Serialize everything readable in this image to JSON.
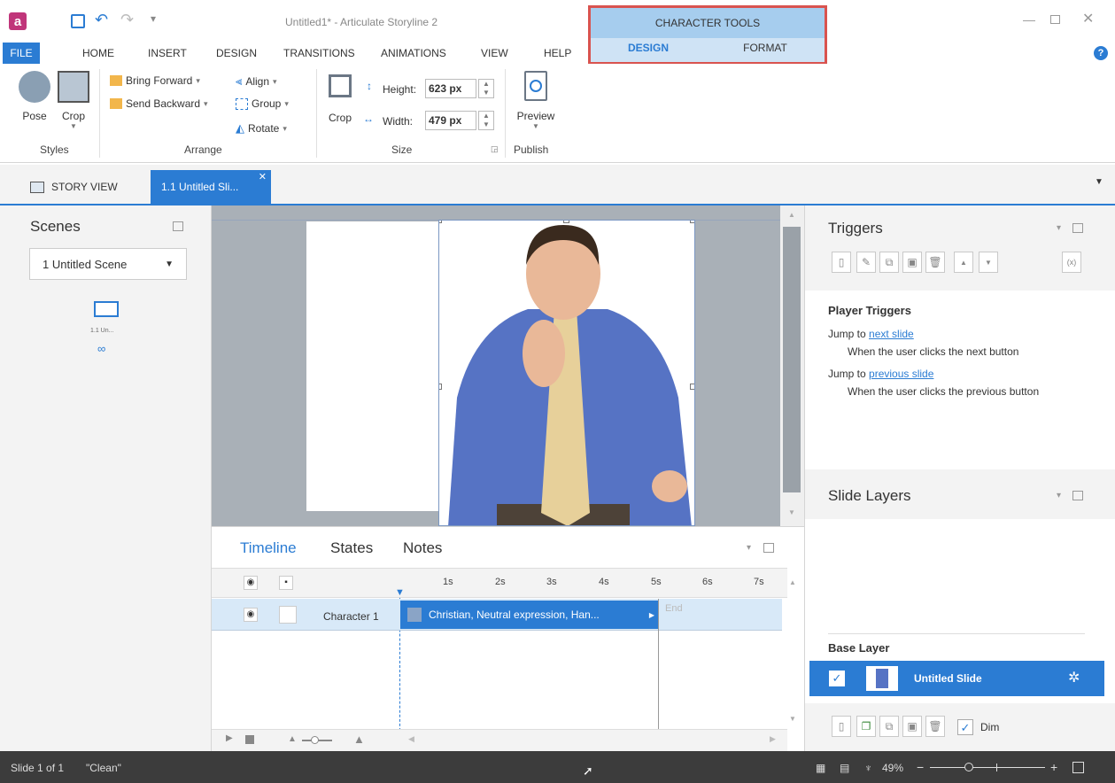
{
  "window": {
    "title": "Untitled1* - Articulate Storyline 2"
  },
  "app_icon": "storyline-a-icon",
  "context_tab": {
    "header": "CHARACTER TOOLS",
    "tabs": [
      "DESIGN",
      "FORMAT"
    ]
  },
  "menu": {
    "file": "FILE",
    "items": [
      "HOME",
      "INSERT",
      "DESIGN",
      "TRANSITIONS",
      "ANIMATIONS",
      "VIEW",
      "HELP"
    ]
  },
  "ribbon": {
    "styles": {
      "pose": "Pose",
      "crop": "Crop",
      "label": "Styles"
    },
    "arrange": {
      "bring_forward": "Bring Forward",
      "send_backward": "Send Backward",
      "align": "Align",
      "group": "Group",
      "rotate": "Rotate",
      "label": "Arrange"
    },
    "size": {
      "crop": "Crop",
      "height_label": "Height:",
      "height_value": "623 px",
      "width_label": "Width:",
      "width_value": "479 px",
      "label": "Size"
    },
    "publish": {
      "preview": "Preview",
      "label": "Publish"
    }
  },
  "tabs": {
    "story_view": "STORY VIEW",
    "slide_tab": "1.1 Untitled Sli..."
  },
  "scenes": {
    "title": "Scenes",
    "dropdown": "1 Untitled Scene",
    "thumb_label": "1.1 Un..."
  },
  "triggers": {
    "title": "Triggers",
    "section": "Player Triggers",
    "items": [
      {
        "action": "Jump to",
        "target": "next slide",
        "condition": "When the user clicks the next button"
      },
      {
        "action": "Jump to",
        "target": "previous slide",
        "condition": "When the user clicks the previous button"
      }
    ]
  },
  "slide_layers": {
    "title": "Slide Layers",
    "base_label": "Base Layer",
    "slide_name": "Untitled Slide",
    "dim": "Dim"
  },
  "timeline": {
    "tabs": [
      "Timeline",
      "States",
      "Notes"
    ],
    "ticks": [
      "1s",
      "2s",
      "3s",
      "4s",
      "5s",
      "6s",
      "7s"
    ],
    "row_name": "Character 1",
    "clip_label": "Christian, Neutral expression, Han...",
    "end_label": "End"
  },
  "status": {
    "slide": "Slide 1 of 1",
    "theme": "\"Clean\"",
    "zoom": "49%",
    "zoom_level": 0.49
  },
  "colors": {
    "accent": "#2b7cd3",
    "context_highlight": "#d9534f",
    "context_bg": "#a6cdee"
  }
}
